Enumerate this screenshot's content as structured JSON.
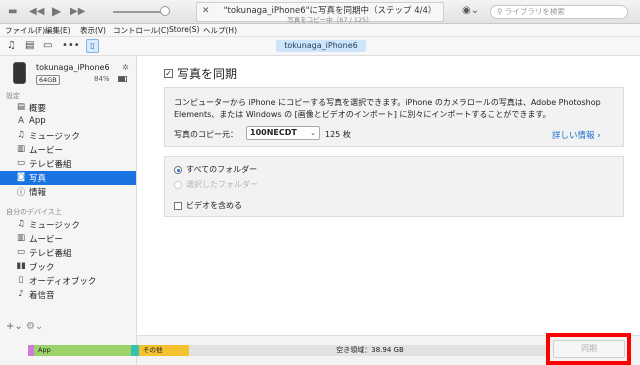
{
  "window": {
    "now_playing_title": "\"tokunaga_iPhone6\"に写真を同期中（ステップ 4/4）",
    "now_playing_sub": "写真をコピー中（67 / 125）",
    "search_placeholder": "ライブラリを検索"
  },
  "menu": [
    "ファイル(F)",
    "編集(E)",
    "表示(V)",
    "コントロール(C)",
    "Store(S)",
    "ヘルプ(H)"
  ],
  "device": {
    "pill": "tokunaga_iPhone6",
    "name": "tokunaga_iPhone6",
    "capacity": "64GB",
    "battery": "84%",
    "battery_level": 0.84
  },
  "sidebar": {
    "settings_header": "設定",
    "settings": [
      {
        "icon": "summary-icon",
        "label": "概要"
      },
      {
        "icon": "app-icon",
        "label": "App"
      },
      {
        "icon": "music-icon",
        "label": "ミュージック"
      },
      {
        "icon": "movie-icon",
        "label": "ムービー"
      },
      {
        "icon": "tv-icon",
        "label": "テレビ番組"
      },
      {
        "icon": "camera-icon",
        "label": "写真"
      },
      {
        "icon": "info-icon",
        "label": "情報"
      }
    ],
    "on_device_header": "自分のデバイス上",
    "on_device": [
      {
        "icon": "music-icon",
        "label": "ミュージック"
      },
      {
        "icon": "movie-icon",
        "label": "ムービー"
      },
      {
        "icon": "tv-icon",
        "label": "テレビ番組"
      },
      {
        "icon": "book-icon",
        "label": "ブック"
      },
      {
        "icon": "audiobook-icon",
        "label": "オーディオブック"
      },
      {
        "icon": "bell-icon",
        "label": "着信音"
      }
    ]
  },
  "photos": {
    "sync_label": "写真を同期",
    "sync_checked": true,
    "description": "コンピューターから iPhone にコピーする写真を選択できます。iPhone のカメラロールの写真は、Adobe Photoshop Elements、または Windows の [画像とビデオのインポート] に別々にインポートすることができます。",
    "copy_label": "写真のコピー元：",
    "copy_source": "100NECDT",
    "copy_count": "125 枚",
    "more_info": "詳しい情報 ›",
    "option_all": "すべてのフォルダー",
    "option_selected": "選択したフォルダー",
    "include_videos": "ビデオを含める"
  },
  "storage": {
    "app_label": "App",
    "other_label": "その他",
    "free_label": "空き領域：38.94 GB",
    "colors": {
      "photos": "#d27ad9",
      "app": "#9bd36a",
      "docs": "#35c2b0",
      "other": "#f3c22e",
      "free": "#e2e2e2"
    },
    "sync_button": "同期"
  }
}
